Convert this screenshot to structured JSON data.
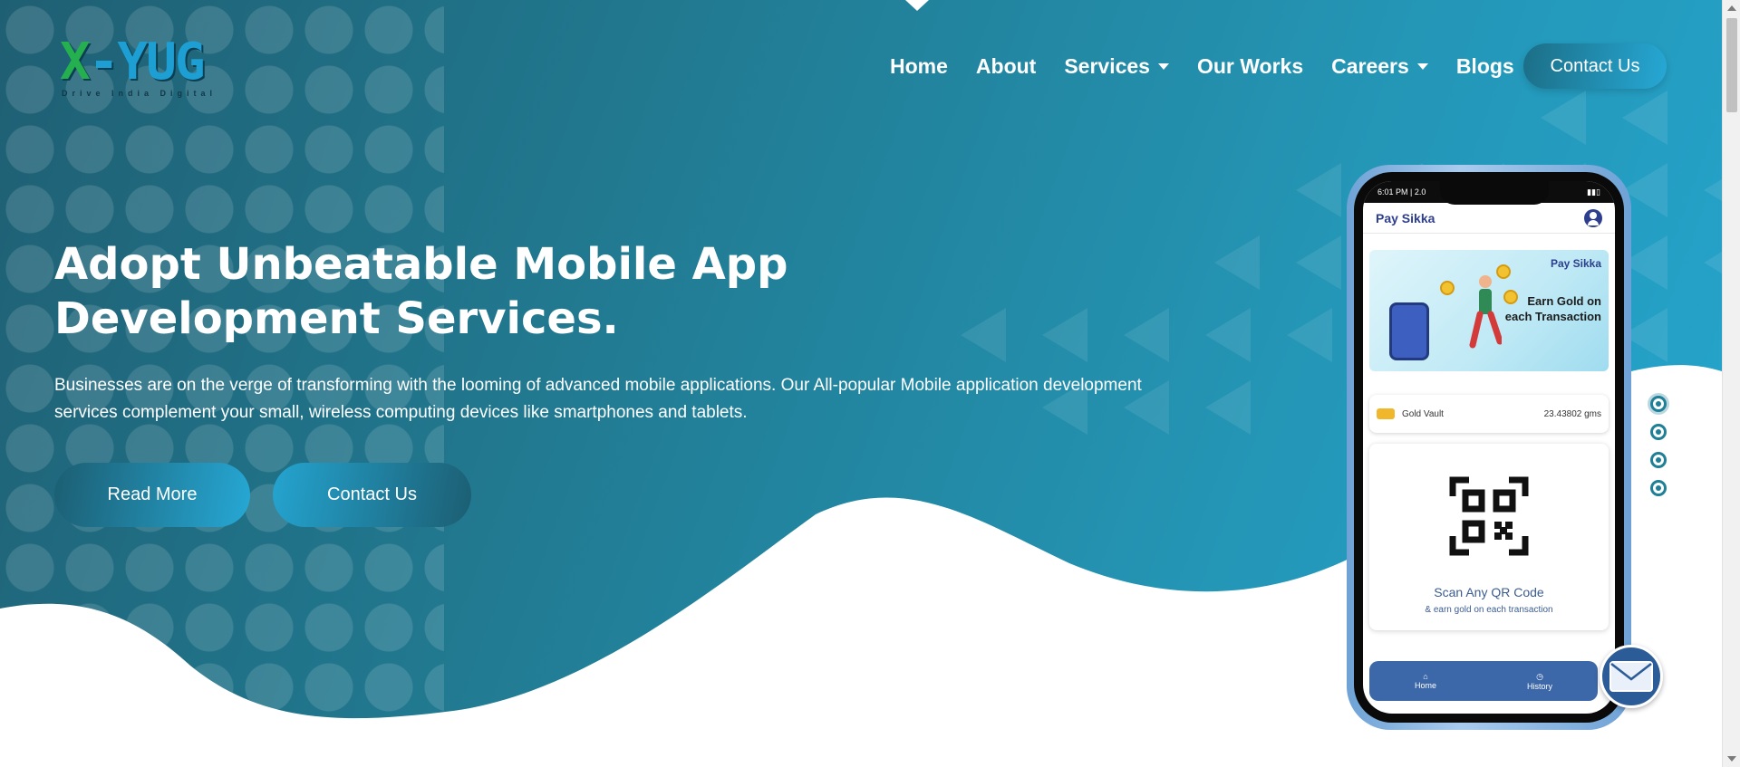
{
  "logo": {
    "text_x": "X",
    "text_main": "-YUG",
    "tagline": "Drive India Digital"
  },
  "nav": {
    "items": [
      {
        "label": "Home",
        "dropdown": false
      },
      {
        "label": "About",
        "dropdown": false
      },
      {
        "label": "Services",
        "dropdown": true
      },
      {
        "label": "Our Works",
        "dropdown": false
      },
      {
        "label": "Careers",
        "dropdown": true
      },
      {
        "label": "Blogs",
        "dropdown": false
      }
    ],
    "contact_label": "Contact Us"
  },
  "hero": {
    "headline": "Adopt Unbeatable Mobile App Development Services.",
    "description": "Businesses are on the verge of transforming with the looming of advanced mobile applications. Our All-popular Mobile application development services complement your small, wireless computing devices like smartphones and tablets.",
    "read_more_label": "Read More",
    "contact_label": "Contact Us"
  },
  "phone": {
    "status_left": "6:01 PM | 2.0",
    "brand": "Pay Sikka",
    "banner_brand": "Pay Sikka",
    "banner_text": "Earn Gold on each Transaction",
    "vault_label": "Gold Vault",
    "vault_value": "23.43802 gms",
    "qr_title": "Scan Any QR Code",
    "qr_subtitle": "& earn gold on each transaction",
    "tabs": [
      {
        "label": "Home",
        "icon": "home-icon"
      },
      {
        "label": "History",
        "icon": "clock-icon"
      }
    ]
  },
  "slider": {
    "count": 4,
    "active_index": 0
  },
  "colors": {
    "hero_dark": "#1f5f73",
    "hero_light": "#25a6cf",
    "accent": "#1e7f97"
  }
}
